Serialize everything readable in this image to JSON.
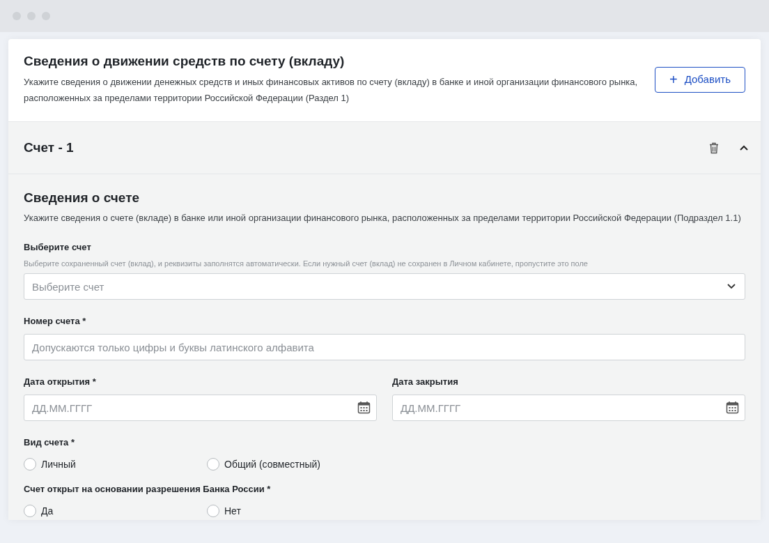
{
  "section": {
    "title": "Сведения о движении средств по счету (вкладу)",
    "description": "Укажите сведения о движении денежных средств и иных финансовых активов по счету (вкладу) в банке и иной организации финансового рынка, расположенных за пределами территории Российской Федерации (Раздел 1)",
    "add_button": {
      "icon": "+",
      "label": "Добавить"
    }
  },
  "account": {
    "title": "Счет - 1",
    "expanded": true,
    "subsection": {
      "title": "Сведения о счете",
      "description": "Укажите сведения о счете (вкладе) в банке или иной организации финансового рынка, расположенных за пределами территории Российской Федерации (Подраздел 1.1)"
    },
    "fields": [
      {
        "kind": "select",
        "label": "Выберите счет",
        "hint": "Выберите сохраненный счет (вклад), и реквизиты заполнятся автоматически. Если нужный счет (вклад) не сохранен в Личном кабинете, пропустите это поле",
        "placeholder": "Выберите счет"
      },
      {
        "kind": "text",
        "label": "Номер счета *",
        "placeholder": "Допускаются только цифры и буквы латинского алфавита"
      },
      {
        "kind": "dates",
        "items": [
          {
            "label": "Дата открытия *",
            "placeholder": "ДД.ММ.ГГГГ"
          },
          {
            "label": "Дата закрытия",
            "placeholder": "ДД.ММ.ГГГГ"
          }
        ]
      },
      {
        "kind": "radio",
        "label": "Вид счета *",
        "options": [
          {
            "label": "Личный",
            "selected": false
          },
          {
            "label": "Общий (совместный)",
            "selected": false
          }
        ]
      },
      {
        "kind": "radio",
        "label": "Счет открыт на основании разрешения Банка России *",
        "options": [
          {
            "label": "Да",
            "selected": false
          },
          {
            "label": "Нет",
            "selected": false
          }
        ]
      }
    ]
  }
}
